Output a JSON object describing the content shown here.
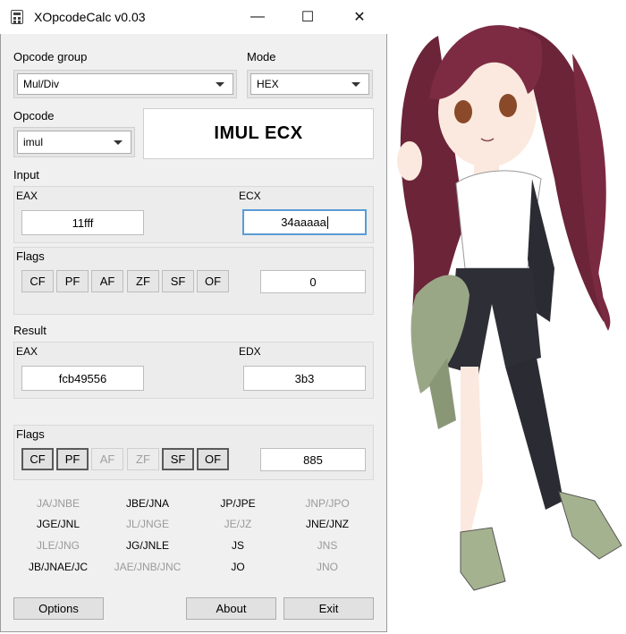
{
  "window": {
    "title": "XOpcodeCalc v0.03",
    "min_glyph": "—",
    "max_glyph": "☐",
    "close_glyph": "✕"
  },
  "opcode_group": {
    "label": "Opcode group",
    "value": "Mul/Div"
  },
  "mode": {
    "label": "Mode",
    "value": "HEX"
  },
  "opcode": {
    "label": "Opcode",
    "value": "imul"
  },
  "instruction": "IMUL ECX",
  "input": {
    "label": "Input",
    "eax_label": "EAX",
    "eax_value": "11fff",
    "ecx_label": "ECX",
    "ecx_value": "34aaaaa",
    "flags_label": "Flags",
    "flags_value": "0",
    "flags": [
      {
        "name": "CF",
        "state": "normal"
      },
      {
        "name": "PF",
        "state": "normal"
      },
      {
        "name": "AF",
        "state": "normal"
      },
      {
        "name": "ZF",
        "state": "normal"
      },
      {
        "name": "SF",
        "state": "normal"
      },
      {
        "name": "OF",
        "state": "normal"
      }
    ]
  },
  "result": {
    "label": "Result",
    "eax_label": "EAX",
    "eax_value": "fcb49556",
    "edx_label": "EDX",
    "edx_value": "3b3",
    "flags_label": "Flags",
    "flags_value": "885",
    "flags": [
      {
        "name": "CF",
        "state": "on"
      },
      {
        "name": "PF",
        "state": "on"
      },
      {
        "name": "AF",
        "state": "off"
      },
      {
        "name": "ZF",
        "state": "off"
      },
      {
        "name": "SF",
        "state": "on"
      },
      {
        "name": "OF",
        "state": "on"
      }
    ]
  },
  "jumps": [
    [
      {
        "text": "JA/JNBE",
        "active": false
      },
      {
        "text": "JBE/JNA",
        "active": true
      },
      {
        "text": "JP/JPE",
        "active": true
      },
      {
        "text": "JNP/JPO",
        "active": false
      }
    ],
    [
      {
        "text": "JGE/JNL",
        "active": true
      },
      {
        "text": "JL/JNGE",
        "active": false
      },
      {
        "text": "JE/JZ",
        "active": false
      },
      {
        "text": "JNE/JNZ",
        "active": true
      }
    ],
    [
      {
        "text": "JLE/JNG",
        "active": false
      },
      {
        "text": "JG/JNLE",
        "active": true
      },
      {
        "text": "JS",
        "active": true
      },
      {
        "text": "JNS",
        "active": false
      }
    ],
    [
      {
        "text": "JB/JNAE/JC",
        "active": true
      },
      {
        "text": "JAE/JNB/JNC",
        "active": false
      },
      {
        "text": "JO",
        "active": true
      },
      {
        "text": "JNO",
        "active": false
      }
    ]
  ],
  "buttons": {
    "options": "Options",
    "about": "About",
    "exit": "Exit"
  },
  "colors": {
    "focus_border": "#5b9bd5",
    "window_bg": "#f0f0f0"
  }
}
